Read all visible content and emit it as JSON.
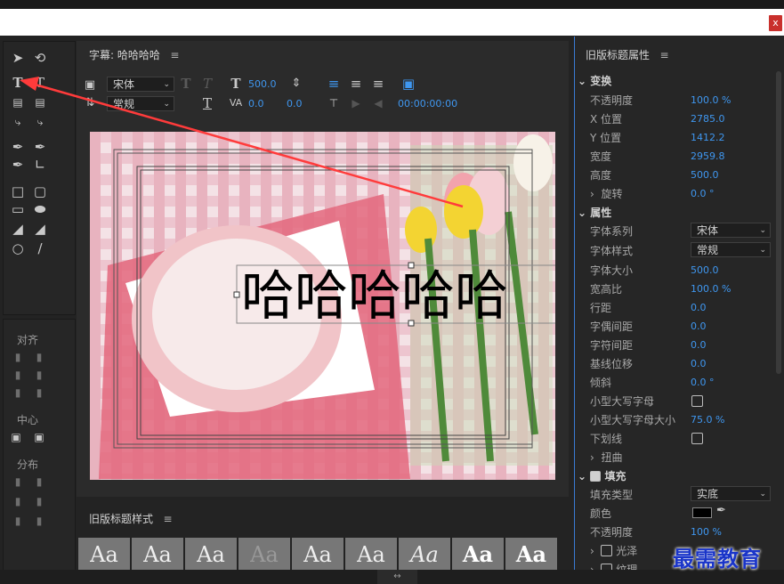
{
  "window": {
    "close_label": "x"
  },
  "main": {
    "title": "字幕: 哈哈哈哈",
    "font_family": "宋体",
    "font_style": "常规",
    "font_size": "500.0",
    "kerning": "0.0",
    "tracking_value": "0.0",
    "timecode": "00:00:00:00",
    "canvas_text": "哈哈哈哈哈"
  },
  "tools_panel": {
    "align_label": "对齐",
    "center_label": "中心",
    "distribute_label": "分布"
  },
  "styles": {
    "title": "旧版标题样式",
    "swatch_label": "Aa"
  },
  "props": {
    "title": "旧版标题属性",
    "transform_group": "变换",
    "opacity_label": "不透明度",
    "opacity_value": "100.0 %",
    "x_label": "X 位置",
    "x_value": "2785.0",
    "y_label": "Y 位置",
    "y_value": "1412.2",
    "width_label": "宽度",
    "width_value": "2959.8",
    "height_label": "高度",
    "height_value": "500.0",
    "rotation_label": "旋转",
    "rotation_value": "0.0 °",
    "attributes_group": "属性",
    "font_family_label": "字体系列",
    "font_family_value": "宋体",
    "font_style_label": "字体样式",
    "font_style_value": "常规",
    "font_size_label": "字体大小",
    "font_size_value": "500.0",
    "aspect_label": "宽高比",
    "aspect_value": "100.0 %",
    "leading_label": "行距",
    "leading_value": "0.0",
    "kerning_label": "字偶间距",
    "kerning_value": "0.0",
    "tracking_label": "字符间距",
    "tracking_value": "0.0",
    "baseline_label": "基线位移",
    "baseline_value": "0.0",
    "slant_label": "倾斜",
    "slant_value": "0.0 °",
    "smallcaps_label": "小型大写字母",
    "smallcaps_size_label": "小型大写字母大小",
    "smallcaps_size_value": "75.0 %",
    "underline_label": "下划线",
    "distort_label": "扭曲",
    "fill_group": "填充",
    "fill_type_label": "填充类型",
    "fill_type_value": "实底",
    "color_label": "颜色",
    "fill_opacity_label": "不透明度",
    "fill_opacity_value": "100 %",
    "sheen_label": "光泽",
    "texture_label": "纹理"
  },
  "watermark": "最需教育",
  "colors": {
    "accent": "#3f97f0",
    "arrow": "#ff3b3b",
    "fill_color": "#000000"
  }
}
